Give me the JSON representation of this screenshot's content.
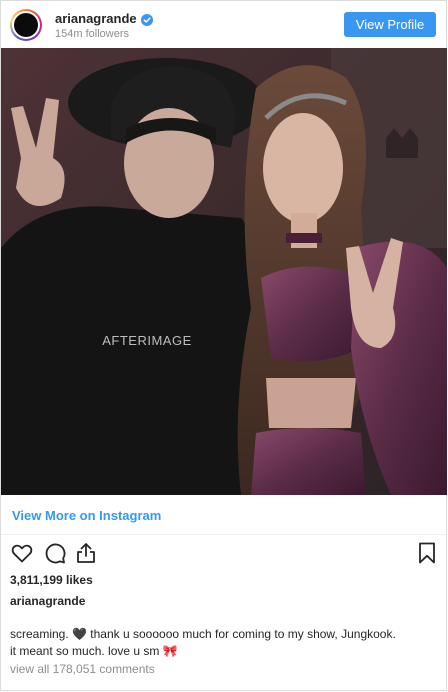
{
  "header": {
    "username": "arianagrande",
    "followers": "154m followers",
    "view_profile_label": "View Profile"
  },
  "photo": {
    "shirt_text": "AFTERIMAGE"
  },
  "link": {
    "more_label": "View More on Instagram"
  },
  "post": {
    "likes": "3,811,199 likes",
    "caption_username": "arianagrande",
    "caption_line1": "screaming. 🖤 thank u soooooo much for coming to my show, Jungkook.",
    "caption_line2": "it meant so much. love u sm 🎀",
    "view_comments": "view all 178,051 comments"
  },
  "colors": {
    "accent": "#3897f0",
    "text": "#262626",
    "muted": "#8e8e8e"
  },
  "icons": [
    "verified-badge-icon",
    "heart-icon",
    "comment-icon",
    "share-icon",
    "bookmark-icon"
  ]
}
